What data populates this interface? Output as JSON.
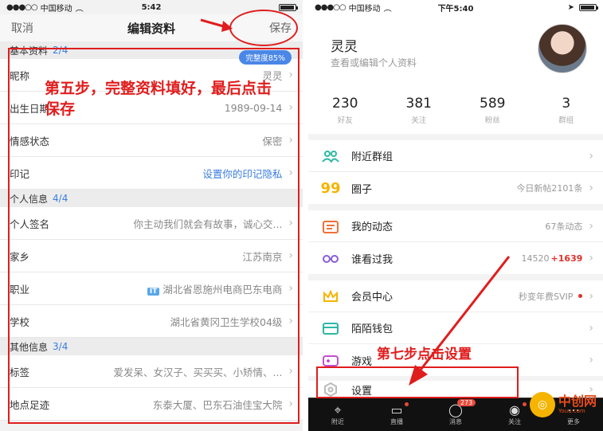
{
  "left": {
    "status": {
      "carrier": "中国移动",
      "time": "5:42"
    },
    "nav": {
      "cancel": "取消",
      "title": "编辑资料",
      "save": "保存"
    },
    "sections": [
      {
        "title": "基本资料",
        "count": "2/4",
        "rows": [
          {
            "label": "昵称",
            "value": "灵灵"
          },
          {
            "label": "出生日期",
            "value": "1989-09-14"
          },
          {
            "label": "情感状态",
            "value": "保密"
          },
          {
            "label": "印记",
            "value": "设置你的印记隐私"
          }
        ]
      },
      {
        "title": "个人信息",
        "count": "4/4",
        "rows": [
          {
            "label": "个人签名",
            "value": "你主动我们就会有故事，诚心交..."
          },
          {
            "label": "家乡",
            "value": "江苏南京"
          },
          {
            "label": "职业",
            "badge": "IT",
            "value": "湖北省恩施州电商巴东电商"
          },
          {
            "label": "学校",
            "value": "湖北省黄冈卫生学校04级"
          }
        ]
      },
      {
        "title": "其他信息",
        "count": "3/4",
        "rows": [
          {
            "label": "标签",
            "value": "爱发呆、女汉子、买买买、小矫情、..."
          },
          {
            "label": "地点足迹",
            "value": "东泰大厦、巴东石油佳宝大院"
          }
        ]
      }
    ],
    "completeness": "完整度85%",
    "annotation": "第五步，完整资料填好，最后点击保存"
  },
  "right": {
    "status": {
      "carrier": "中国移动",
      "time": "下午5:40"
    },
    "profile": {
      "name": "灵灵",
      "subtitle": "查看或编辑个人资料"
    },
    "stats": [
      {
        "num": "230",
        "label": "好友"
      },
      {
        "num": "381",
        "label": "关注"
      },
      {
        "num": "589",
        "label": "粉丝"
      },
      {
        "num": "3",
        "label": "群组"
      }
    ],
    "menu": {
      "groups": {
        "label": "附近群组"
      },
      "circle": {
        "label": "圈子",
        "detail": "今日新帖2101条"
      },
      "moments": {
        "label": "我的动态",
        "detail": "67条动态"
      },
      "visitors": {
        "label": "谁看过我",
        "detail": "14520",
        "detail_red": "+1639"
      },
      "vip": {
        "label": "会员中心",
        "detail": "秒变年费SVIP"
      },
      "wallet": {
        "label": "陌陌钱包"
      },
      "games": {
        "label": "游戏"
      },
      "settings": {
        "label": "设置"
      }
    },
    "tabs": [
      {
        "label": "附近",
        "icon": "location-icon"
      },
      {
        "label": "直播",
        "icon": "video-icon"
      },
      {
        "label": "消息",
        "icon": "chat-icon",
        "badge": "273"
      },
      {
        "label": "关注",
        "icon": "eye-icon"
      },
      {
        "label": "更多",
        "icon": "more-icon"
      }
    ],
    "annotation": "第七步点击设置"
  },
  "watermark": {
    "text": "中创网",
    "sub": "Youu.com"
  },
  "colors": {
    "annotation_red": "#e01d1d",
    "link_blue": "#3a7de0",
    "accent_yellow": "#f5b400"
  }
}
